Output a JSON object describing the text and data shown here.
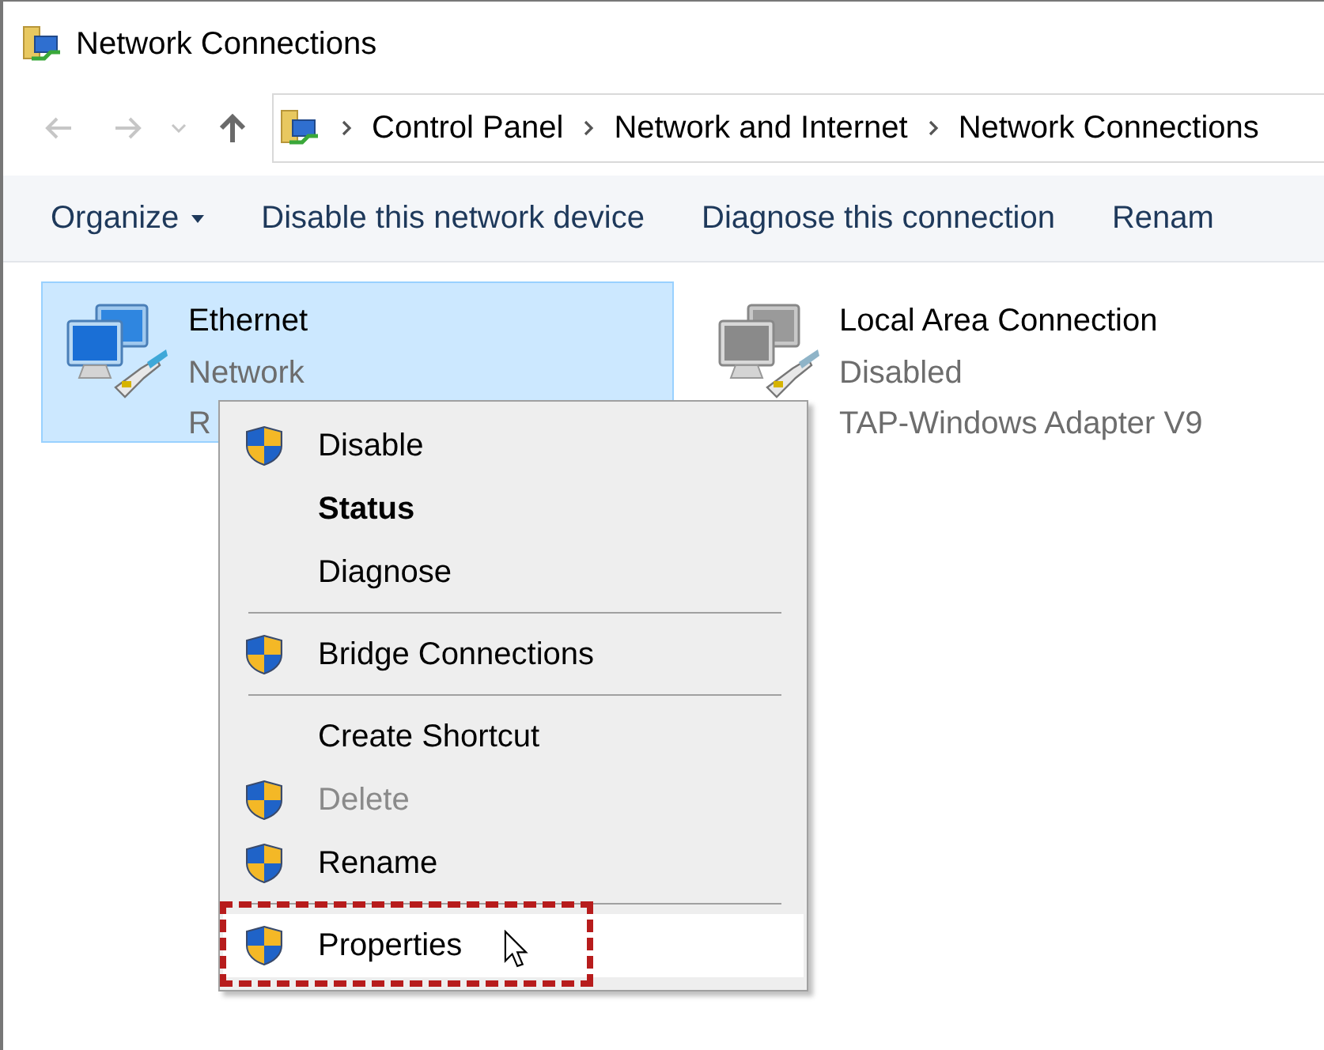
{
  "window": {
    "title": "Network Connections"
  },
  "address_bar": {
    "crumbs": [
      "Control Panel",
      "Network and Internet",
      "Network Connections"
    ]
  },
  "toolbar": [
    {
      "label": "Organize",
      "dropdown": true
    },
    {
      "label": "Disable this network device",
      "dropdown": false
    },
    {
      "label": "Diagnose this connection",
      "dropdown": false
    },
    {
      "label": "Renam",
      "dropdown": false
    }
  ],
  "connections": [
    {
      "name": "Ethernet",
      "status": "Network",
      "adapter": "R",
      "selected": true,
      "disabled": false
    },
    {
      "name": "Local Area Connection",
      "status": "Disabled",
      "adapter": "TAP-Windows Adapter V9",
      "selected": false,
      "disabled": true
    }
  ],
  "context_menu": [
    {
      "kind": "item",
      "label": "Disable",
      "shield": true,
      "bold": false,
      "disabled": false,
      "selected": false,
      "annotated": false
    },
    {
      "kind": "item",
      "label": "Status",
      "shield": false,
      "bold": true,
      "disabled": false,
      "selected": false,
      "annotated": false
    },
    {
      "kind": "item",
      "label": "Diagnose",
      "shield": false,
      "bold": false,
      "disabled": false,
      "selected": false,
      "annotated": false
    },
    {
      "kind": "separator"
    },
    {
      "kind": "item",
      "label": "Bridge Connections",
      "shield": true,
      "bold": false,
      "disabled": false,
      "selected": false,
      "annotated": false
    },
    {
      "kind": "separator"
    },
    {
      "kind": "item",
      "label": "Create Shortcut",
      "shield": false,
      "bold": false,
      "disabled": false,
      "selected": false,
      "annotated": false
    },
    {
      "kind": "item",
      "label": "Delete",
      "shield": true,
      "bold": false,
      "disabled": true,
      "selected": false,
      "annotated": false
    },
    {
      "kind": "item",
      "label": "Rename",
      "shield": true,
      "bold": false,
      "disabled": false,
      "selected": false,
      "annotated": false
    },
    {
      "kind": "separator"
    },
    {
      "kind": "item",
      "label": "Properties",
      "shield": true,
      "bold": false,
      "disabled": false,
      "selected": true,
      "annotated": true
    }
  ]
}
